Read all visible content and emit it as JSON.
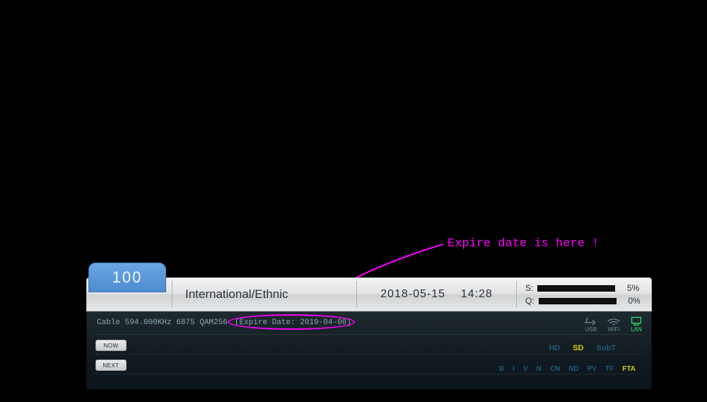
{
  "annotation": {
    "text": "Expire date is here !"
  },
  "channel": {
    "number": "100"
  },
  "program": {
    "name": "International/Ethnic"
  },
  "datetime": {
    "date": "2018-05-15",
    "time": "14:28"
  },
  "signal": {
    "s_label": "S:",
    "s_pct": "5%",
    "q_label": "Q:",
    "q_pct": "0%"
  },
  "tuning": {
    "line": "Cable 594.000KHz 6875 QAM256",
    "expire_label": "[Expire Date: 2019-04-06]"
  },
  "buttons": {
    "now": "NOW",
    "next": "NEXT"
  },
  "conn": {
    "usb": "USB",
    "wifi": "WIFI",
    "lan": "LAN"
  },
  "formats": {
    "hd": "HD",
    "sd": "SD",
    "subt": "SubT"
  },
  "flags": {
    "b": "B",
    "i": "I",
    "v": "V",
    "n": "N",
    "cn": "CN",
    "nd": "ND",
    "pv": "PV",
    "tf": "TF",
    "fta": "FTA"
  }
}
